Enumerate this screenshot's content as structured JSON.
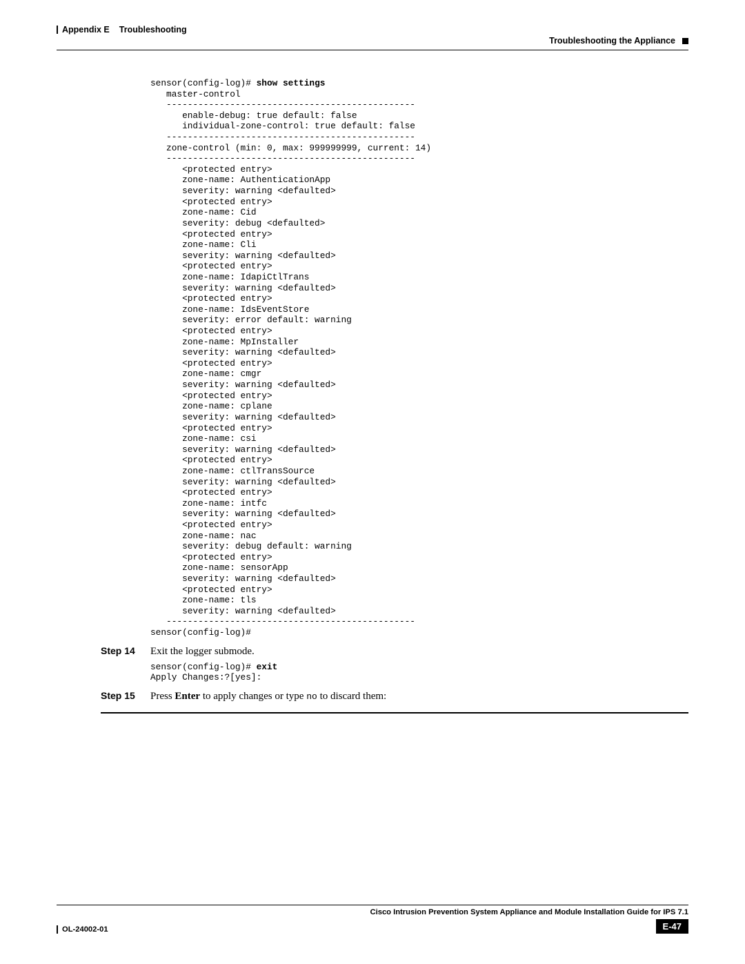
{
  "header": {
    "left_prefix": "Appendix E",
    "left_title": "Troubleshooting",
    "right_title": "Troubleshooting the Appliance"
  },
  "code1": {
    "prompt": "sensor(config-log)# ",
    "command": "show settings",
    "body": "   master-control\n   -----------------------------------------------\n      enable-debug: true default: false\n      individual-zone-control: true default: false\n   -----------------------------------------------\n   zone-control (min: 0, max: 999999999, current: 14)\n   -----------------------------------------------\n      <protected entry>\n      zone-name: AuthenticationApp\n      severity: warning <defaulted>\n      <protected entry>\n      zone-name: Cid\n      severity: debug <defaulted>\n      <protected entry>\n      zone-name: Cli\n      severity: warning <defaulted>\n      <protected entry>\n      zone-name: IdapiCtlTrans\n      severity: warning <defaulted>\n      <protected entry>\n      zone-name: IdsEventStore\n      severity: error default: warning\n      <protected entry>\n      zone-name: MpInstaller\n      severity: warning <defaulted>\n      <protected entry>\n      zone-name: cmgr\n      severity: warning <defaulted>\n      <protected entry>\n      zone-name: cplane\n      severity: warning <defaulted>\n      <protected entry>\n      zone-name: csi\n      severity: warning <defaulted>\n      <protected entry>\n      zone-name: ctlTransSource\n      severity: warning <defaulted>\n      <protected entry>\n      zone-name: intfc\n      severity: warning <defaulted>\n      <protected entry>\n      zone-name: nac\n      severity: debug default: warning\n      <protected entry>\n      zone-name: sensorApp\n      severity: warning <defaulted>\n      <protected entry>\n      zone-name: tls\n      severity: warning <defaulted>\n   -----------------------------------------------\nsensor(config-log)#"
  },
  "step14": {
    "label": "Step 14",
    "text": "Exit the logger submode."
  },
  "code2": {
    "prompt": "sensor(config-log)# ",
    "command": "exit",
    "line2": "Apply Changes:?[yes]:"
  },
  "step15": {
    "label": "Step 15",
    "pre": "Press ",
    "bold1": "Enter",
    "mid": " to apply changes or type ",
    "mono": "no",
    "post": " to discard them:"
  },
  "footer": {
    "doc_id": "OL-24002-01",
    "guide_title": "Cisco Intrusion Prevention System Appliance and Module Installation Guide for IPS 7.1",
    "page_num": "E-47"
  }
}
